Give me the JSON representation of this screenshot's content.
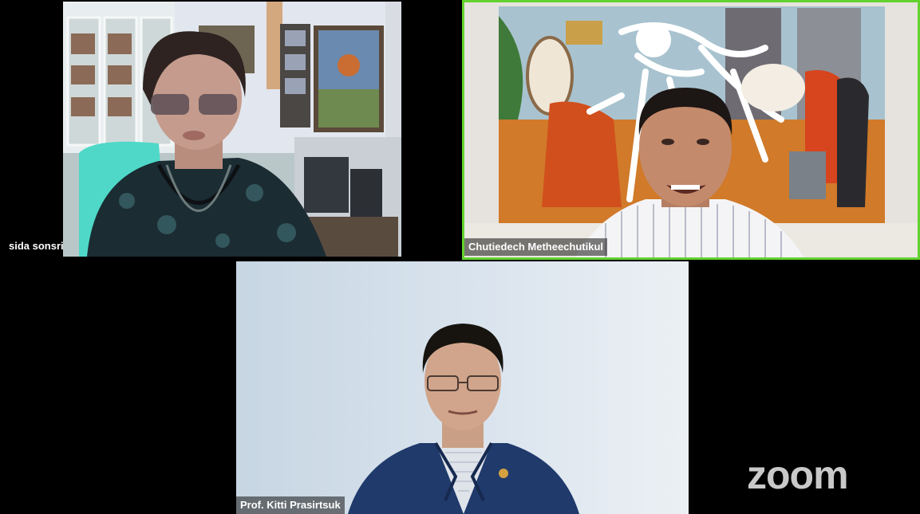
{
  "app": {
    "logo_text": "zoom"
  },
  "participants": [
    {
      "name": "sida sonsri",
      "active_speaker": false
    },
    {
      "name": "Chutiedech Metheechutikul",
      "active_speaker": true
    },
    {
      "name": "Prof. Kitti Prasirtsuk",
      "active_speaker": false
    }
  ],
  "colors": {
    "background": "#000000",
    "active_speaker_border": "#63d22f",
    "logo": "#c9c9c9"
  }
}
